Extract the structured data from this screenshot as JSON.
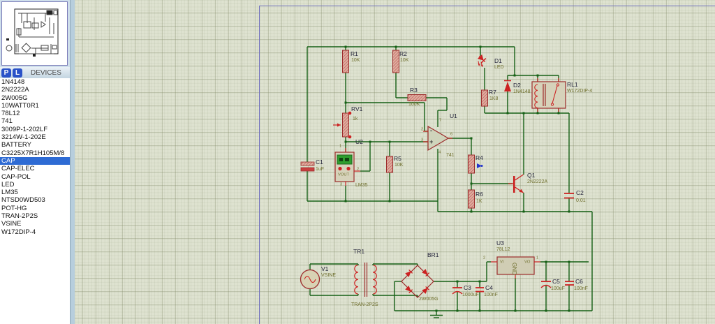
{
  "sidebar": {
    "p_button": "P",
    "l_button": "L",
    "header": "DEVICES",
    "devices": [
      "1N4148",
      "2N2222A",
      "2W005G",
      "10WATT0R1",
      "78L12",
      "741",
      "3009P-1-202LF",
      "3214W-1-202E",
      "BATTERY",
      "C3225X7R1H105M/8",
      "CAP",
      "CAP-ELEC",
      "CAP-POL",
      "LED",
      "LM35",
      "NTSD0WD503",
      "POT-HG",
      "TRAN-2P2S",
      "VSINE",
      "W172DIP-4"
    ],
    "selected_device": "CAP"
  },
  "schematic": {
    "components": [
      {
        "ref": "R1",
        "value": "10K"
      },
      {
        "ref": "R2",
        "value": "10K"
      },
      {
        "ref": "R3",
        "value": "100K"
      },
      {
        "ref": "RV1",
        "value": "1k"
      },
      {
        "ref": "U2",
        "value": "LM35",
        "vout": "VOUT",
        "pin1": "1",
        "pin2": "2",
        "pin3": "3"
      },
      {
        "ref": "R5",
        "value": "10K"
      },
      {
        "ref": "U1",
        "value": "741",
        "pin_inv": "2",
        "pin_noninv": "3",
        "pin_out": "6",
        "pin_vplus": "7",
        "pin_vminus": "4",
        "minus": "-",
        "plus": "+"
      },
      {
        "ref": "C1",
        "value": "1uF"
      },
      {
        "ref": "D1",
        "value": "LED"
      },
      {
        "ref": "R7",
        "value": "1K8"
      },
      {
        "ref": "D2",
        "value": "1N4148"
      },
      {
        "ref": "RL1",
        "value": "W172DIP-4"
      },
      {
        "ref": "R4",
        "value": ""
      },
      {
        "ref": "R6",
        "value": "1K"
      },
      {
        "ref": "Q1",
        "value": "2N2222A"
      },
      {
        "ref": "C2",
        "value": "0.01"
      },
      {
        "ref": "V1",
        "value": "VSINE"
      },
      {
        "ref": "TR1",
        "value": "TRAN-2P2S"
      },
      {
        "ref": "BR1",
        "value": "2W005G"
      },
      {
        "ref": "C3",
        "value": "1000uF"
      },
      {
        "ref": "C4",
        "value": "100nF"
      },
      {
        "ref": "U3",
        "value": "78L12",
        "vi": "VI",
        "vo": "VO",
        "gnd": "GND",
        "pin_in": "2",
        "pin_out": "1"
      },
      {
        "ref": "C5",
        "value": "100uF"
      },
      {
        "ref": "C6",
        "value": "100nF"
      }
    ],
    "colors": {
      "wire": "#156015",
      "component": "#9c2b2b",
      "grid_bg": "#dee2d0",
      "sheet_border": "#7272bd",
      "selection": "#2e6bd4",
      "lcd_green": "#2f9e2f",
      "marker_blue": "#2233cc"
    }
  }
}
